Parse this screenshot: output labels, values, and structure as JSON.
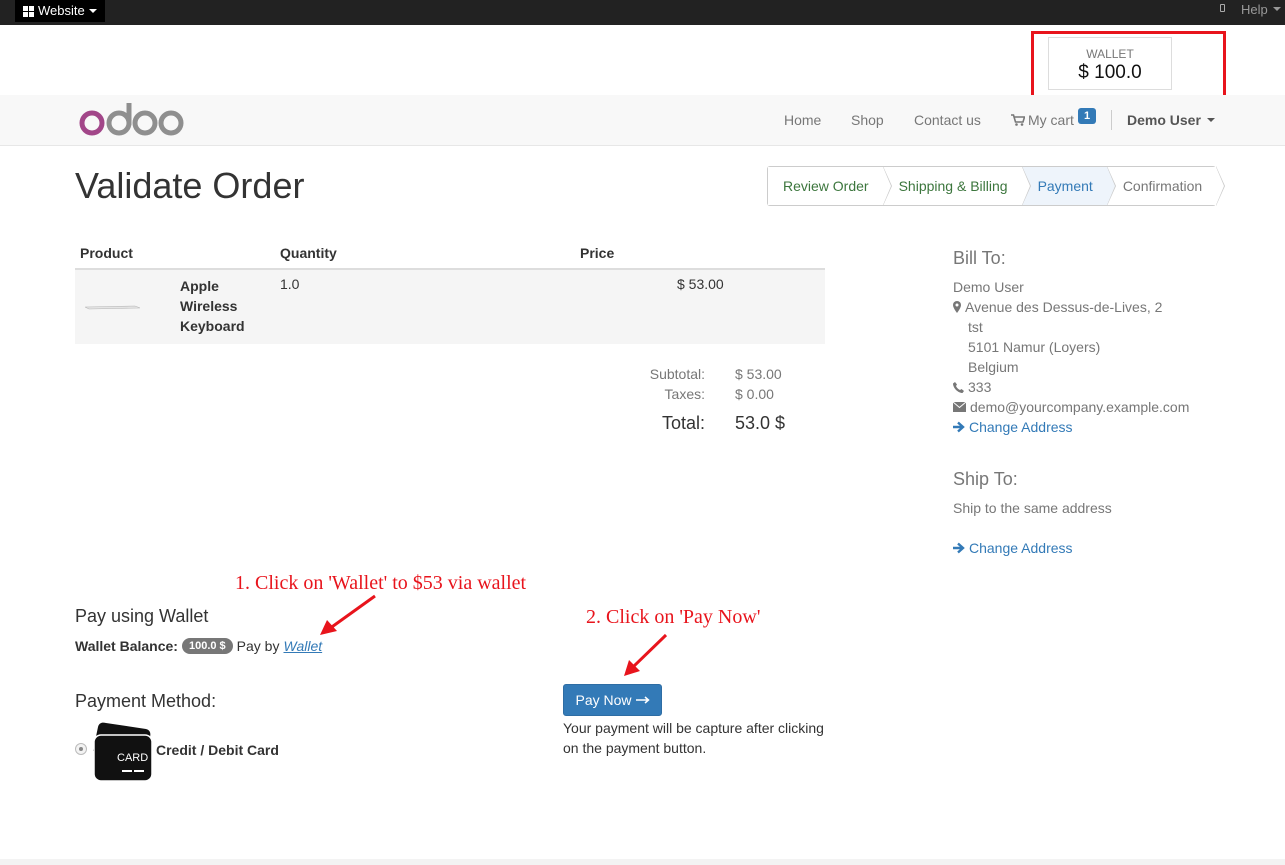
{
  "topbar": {
    "website": "Website",
    "help": "Help"
  },
  "wallet_widget": {
    "label": "WALLET",
    "amount": "$ 100.0"
  },
  "nav": {
    "logo": "odoo",
    "home": "Home",
    "shop": "Shop",
    "contact": "Contact us",
    "cart": "My cart",
    "cart_count": "1",
    "user": "Demo User"
  },
  "page": {
    "title": "Validate Order"
  },
  "steps": [
    "Review Order",
    "Shipping & Billing",
    "Payment",
    "Confirmation"
  ],
  "table": {
    "headers": {
      "product": "Product",
      "quantity": "Quantity",
      "price": "Price"
    },
    "rows": [
      {
        "name": "Apple Wireless Keyboard",
        "quantity": "1.0",
        "price": "$ 53.00"
      }
    ]
  },
  "totals": {
    "subtotal_label": "Subtotal:",
    "subtotal": "$ 53.00",
    "taxes_label": "Taxes:",
    "taxes": "$ 0.00",
    "total_label": "Total:",
    "total": "53.0 $"
  },
  "bill_to": {
    "heading": "Bill To:",
    "name": "Demo User",
    "street": "Avenue des Dessus-de-Lives, 2",
    "street2": "tst",
    "city": "5101 Namur (Loyers)",
    "country": "Belgium",
    "phone": "333",
    "email": "demo@yourcompany.example.com",
    "change": "Change Address"
  },
  "ship_to": {
    "heading": "Ship To:",
    "text": "Ship to the same address",
    "change": "Change Address"
  },
  "annotations": {
    "step1": "1. Click on 'Wallet' to $53 via wallet",
    "step2": "2. Click on 'Pay Now'",
    "color": "#e8141c"
  },
  "wallet_pay": {
    "heading": "Pay using Wallet",
    "balance_label": "Wallet Balance:",
    "balance": "100.0 $",
    "pay_by": "Pay by",
    "link": "Wallet"
  },
  "payment_method": {
    "heading": "Payment Method:",
    "card_text": "CARD",
    "option": "Credit / Debit Card"
  },
  "pay_now": {
    "label": "Pay Now",
    "note": "Your payment will be capture after clicking on the payment button."
  },
  "colors": {
    "primary": "#337ab7",
    "done": "#3c763d",
    "highlight": "#e8141c"
  }
}
